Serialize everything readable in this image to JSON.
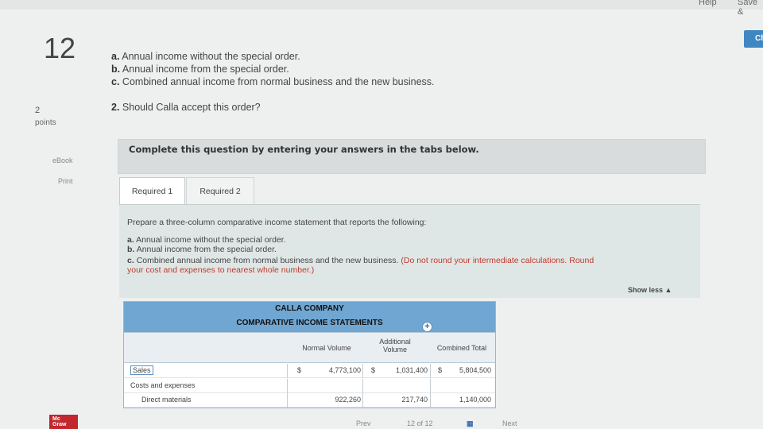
{
  "top": {
    "help": "Help",
    "save": "Save &",
    "check": "Ch"
  },
  "question": {
    "number": "12",
    "points_value": "2",
    "points_label": "points",
    "links": [
      "eBook",
      "Print"
    ],
    "lines": [
      {
        "prefix": "a.",
        "text": "Annual income without the special order."
      },
      {
        "prefix": "b.",
        "text": "Annual income from the special order."
      },
      {
        "prefix": "c.",
        "text": "Combined annual income from normal business and the new business."
      }
    ],
    "q2": {
      "prefix": "2.",
      "text": "Should Calla accept this order?"
    }
  },
  "instructions": "Complete this question by entering your answers in the tabs below.",
  "tabs": [
    "Required 1",
    "Required 2"
  ],
  "content": {
    "intro": "Prepare a three-column comparative income statement that reports the following:",
    "items": [
      {
        "prefix": "a.",
        "text": "Annual income without the special order."
      },
      {
        "prefix": "b.",
        "text": "Annual income from the special order."
      },
      {
        "prefix": "c.",
        "text": "Combined annual income from normal business and the new business."
      }
    ],
    "note_1": "(Do not round your intermediate calculations. Round",
    "note_2": "your cost and expenses to nearest whole number.)",
    "show_less": "Show less ▲"
  },
  "statement": {
    "company": "CALLA COMPANY",
    "title": "COMPARATIVE INCOME STATEMENTS",
    "columns": [
      "Normal Volume",
      "Additional Volume",
      "Combined Total"
    ],
    "rows": [
      {
        "label": "Sales",
        "cur1": "$",
        "normal": "4,773,100",
        "cur2": "$",
        "additional": "1,031,400",
        "cur3": "$",
        "combined": "5,804,500"
      },
      {
        "label": "Costs and expenses",
        "cur1": "",
        "normal": "",
        "cur2": "",
        "additional": "",
        "cur3": "",
        "combined": ""
      },
      {
        "label": "Direct materials",
        "cur1": "",
        "normal": "922,260",
        "cur2": "",
        "additional": "217,740",
        "cur3": "",
        "combined": "1,140,000"
      }
    ]
  },
  "footer": {
    "logo_1": "Mc",
    "logo_2": "Graw",
    "prev": "Prev",
    "page": "12 of 12",
    "next": "Next"
  }
}
